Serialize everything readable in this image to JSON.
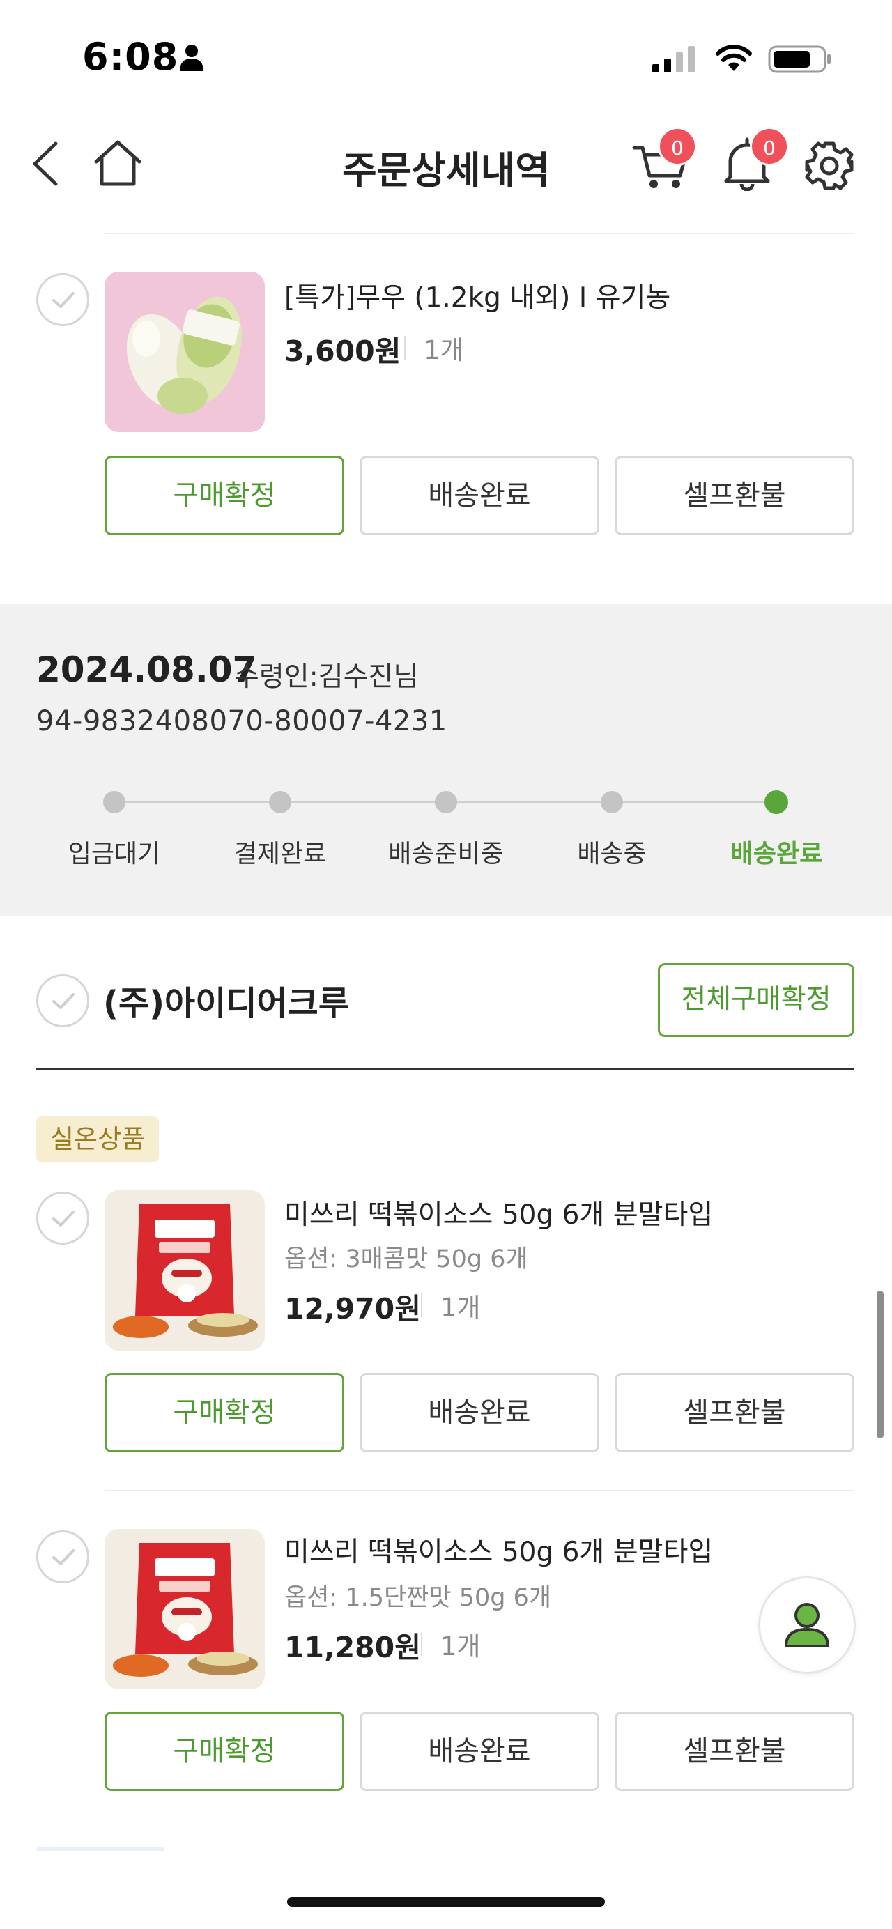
{
  "status_bar": {
    "time": "6:08"
  },
  "header": {
    "title": "주문상세내역",
    "cart_count": "0",
    "notification_count": "0"
  },
  "first_item": {
    "name": "[특가]무우 (1.2kg 내외) I 유기농",
    "price": "3,600원",
    "quantity": "1개",
    "buttons": {
      "confirm": "구매확정",
      "delivered": "배송완료",
      "refund": "셀프환불"
    }
  },
  "shipment": {
    "date": "2024.08.07",
    "recipient": "수령인:김수진님",
    "tracking": "94-9832408070-80007-4231",
    "steps": [
      "입금대기",
      "결제완료",
      "배송준비중",
      "배송중",
      "배송완료"
    ],
    "current_step": 4
  },
  "seller": {
    "name": "(주)아이디어크루",
    "confirm_all": "전체구매확정",
    "tag": "실온상품"
  },
  "items": [
    {
      "name": "미쓰리 떡볶이소스 50g 6개 분말타입",
      "option": "옵션: 3매콤맛 50g 6개",
      "price": "12,970원",
      "quantity": "1개",
      "buttons": {
        "confirm": "구매확정",
        "delivered": "배송완료",
        "refund": "셀프환불"
      }
    },
    {
      "name": "미쓰리 떡볶이소스 50g 6개 분말타입",
      "option": "옵션: 1.5단짠맛 50g 6개",
      "price": "11,280원",
      "quantity": "1개",
      "buttons": {
        "confirm": "구매확정",
        "delivered": "배송완료",
        "refund": "셀프환불"
      }
    }
  ],
  "colors": {
    "accent_green": "#5aa63a",
    "badge_red": "#f0505a",
    "tag_bg": "#f7eed2"
  }
}
